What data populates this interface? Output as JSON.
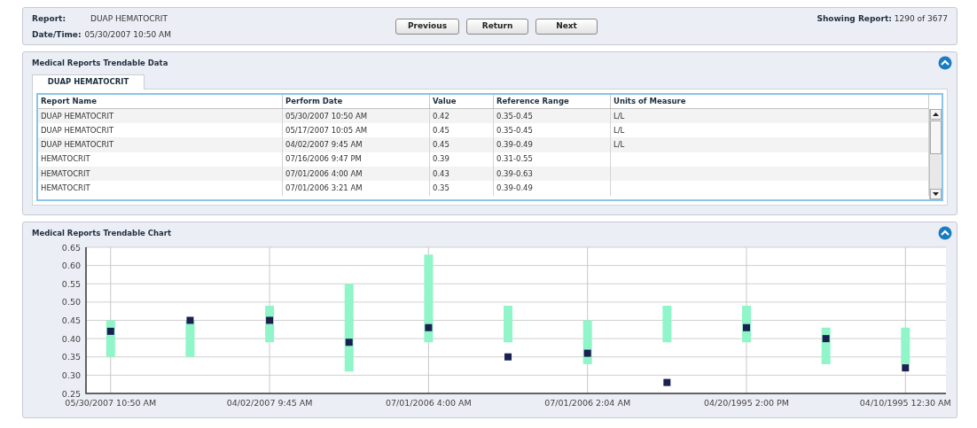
{
  "header": {
    "report_label": "Report:",
    "report_value": "DUAP HEMATOCRIT",
    "datetime_label": "Date/Time:",
    "datetime_value": "05/30/2007 10:50 AM",
    "buttons": [
      "Previous",
      "Return",
      "Next"
    ],
    "showing_label": "Showing Report:",
    "showing_value": "1290 of 3677"
  },
  "data_panel": {
    "title": "Medical Reports Trendable Data",
    "tabs": [
      {
        "label": "DUAP HEMATOCRIT",
        "selected": true
      }
    ],
    "table": {
      "columns": [
        "Report Name",
        "Perform Date",
        "Value",
        "Reference Range",
        "Units of Measure"
      ],
      "rows": [
        [
          "DUAP HEMATOCRIT",
          "05/30/2007 10:50 AM",
          "0.42",
          "0.35-0.45",
          "L/L"
        ],
        [
          "DUAP HEMATOCRIT",
          "05/17/2007 10:05 AM",
          "0.45",
          "0.35-0.45",
          "L/L"
        ],
        [
          "DUAP HEMATOCRIT",
          "04/02/2007 9:45 AM",
          "0.45",
          "0.39-0.49",
          "L/L"
        ],
        [
          "HEMATOCRIT",
          "07/16/2006 9:47 PM",
          "0.39",
          "0.31-0.55",
          ""
        ],
        [
          "HEMATOCRIT",
          "07/01/2006 4:00 AM",
          "0.43",
          "0.39-0.63",
          ""
        ],
        [
          "HEMATOCRIT",
          "07/01/2006 3:21 AM",
          "0.35",
          "0.39-0.49",
          ""
        ]
      ]
    }
  },
  "chart_panel": {
    "title": "Medical Reports Trendable Chart",
    "chart_data": {
      "type": "scatter",
      "categories": [
        "05/30/2007 10:50 AM",
        null,
        "04/02/2007 9:45 AM",
        null,
        "07/01/2006 4:00 AM",
        null,
        "07/01/2006 2:04 AM",
        null,
        "04/20/1995 2:00 PM",
        null,
        "04/10/1995 12:30 AM"
      ],
      "ylim": [
        0.25,
        0.65
      ],
      "yticks": [
        {
          "value": 0.25,
          "label": "0.25"
        },
        {
          "value": 0.3,
          "label": "0.30"
        },
        {
          "value": 0.35,
          "label": "0.35"
        },
        {
          "value": 0.4,
          "label": "0.40"
        },
        {
          "value": 0.45,
          "label": "0.45"
        },
        {
          "value": 0.5,
          "label": "0.50"
        },
        {
          "value": 0.55,
          "label": "0.55"
        },
        {
          "value": 0.6,
          "label": "0.60"
        },
        {
          "value": 0.65,
          "label": "0.65"
        }
      ],
      "series": [
        {
          "color": "#1a2050",
          "values": [
            0.42,
            0.45,
            0.45,
            0.39,
            0.43,
            0.35,
            0.36,
            0.28,
            0.43,
            0.4,
            0.32
          ],
          "errors": [
            [
              0.35,
              0.45
            ],
            [
              0.35,
              0.45
            ],
            [
              0.39,
              0.49
            ],
            [
              0.31,
              0.55
            ],
            [
              0.39,
              0.63
            ],
            [
              0.39,
              0.49
            ],
            [
              0.33,
              0.45
            ],
            [
              0.39,
              0.49
            ],
            [
              0.39,
              0.49
            ],
            [
              0.33,
              0.43
            ],
            [
              0.33,
              0.43
            ]
          ]
        }
      ],
      "grid": true
    }
  }
}
